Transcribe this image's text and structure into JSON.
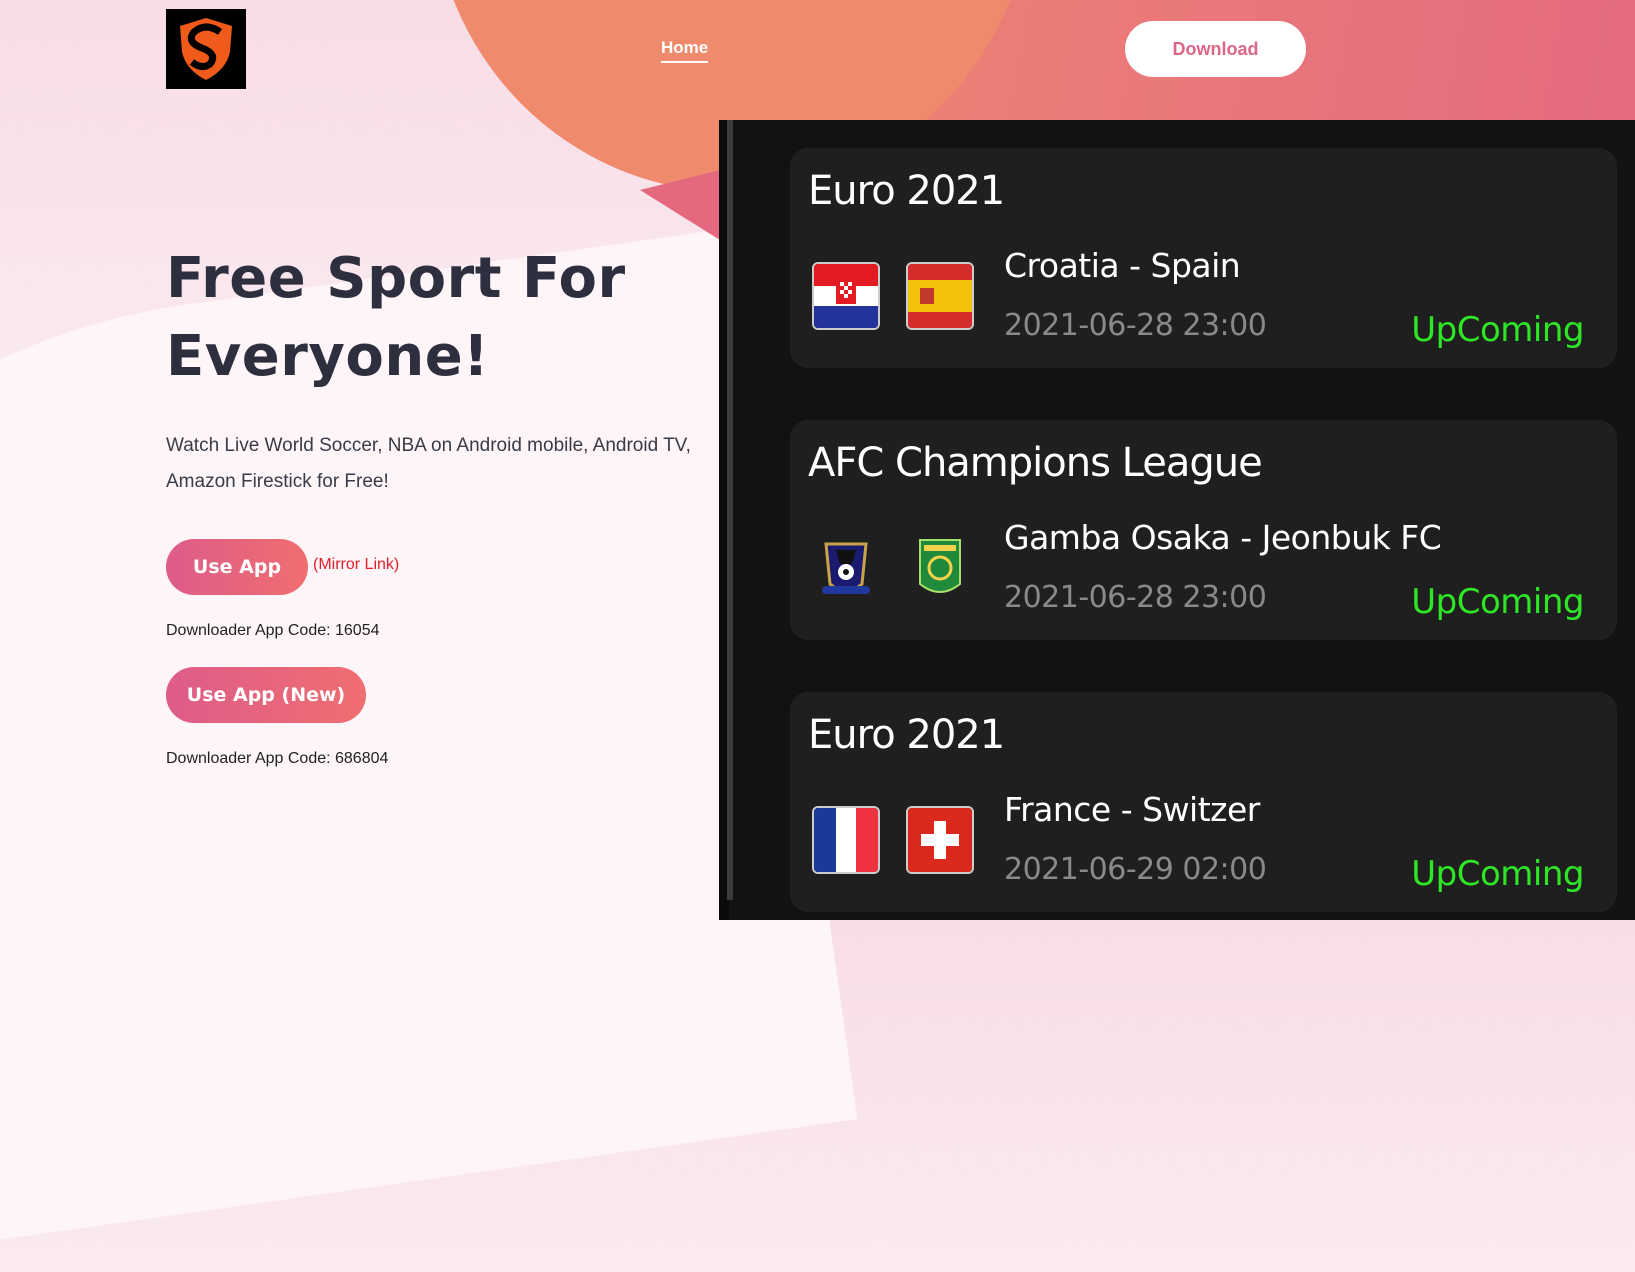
{
  "header": {
    "logo_alt": "S",
    "nav": [
      {
        "label": "Home",
        "active": true
      }
    ],
    "download_label": "Download"
  },
  "hero": {
    "title_line1": "Free Sport For",
    "title_line2": "Everyone!",
    "description": "Watch Live World Soccer, NBA on Android mobile, Android TV, Amazon Firestick for Free!",
    "use_app_label": "Use App",
    "mirror_link_label": "(Mirror Link)",
    "code1": "Downloader App Code: 16054",
    "use_app_new_label": "Use App (New)",
    "code2": "Downloader App Code: 686804"
  },
  "colors": {
    "accent_pink": "#dd6585",
    "status_green": "#2ee626",
    "mirror_red": "#e0202c"
  },
  "matches": [
    {
      "league": "Euro 2021",
      "title": "Croatia - Spain",
      "time": "2021-06-28 23:00",
      "status": "UpComing",
      "team1_icon": "croatia-flag-icon",
      "team2_icon": "spain-flag-icon"
    },
    {
      "league": "AFC Champions League",
      "title": "Gamba Osaka - Jeonbuk FC",
      "time": "2021-06-28 23:00",
      "status": "UpComing",
      "team1_icon": "gamba-osaka-crest-icon",
      "team2_icon": "jeonbuk-crest-icon"
    },
    {
      "league": "Euro 2021",
      "title": "France - Switzer",
      "time": "2021-06-29 02:00",
      "status": "UpComing",
      "team1_icon": "france-flag-icon",
      "team2_icon": "switzerland-flag-icon"
    }
  ]
}
